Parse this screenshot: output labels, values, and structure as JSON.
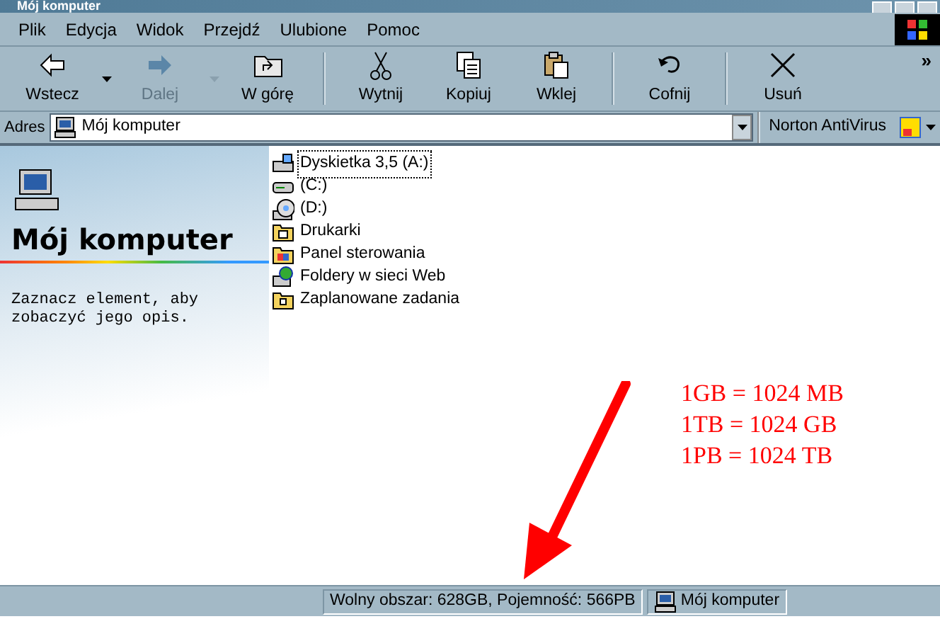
{
  "window": {
    "title": "Mój komputer"
  },
  "menu": [
    "Plik",
    "Edycja",
    "Widok",
    "Przejdź",
    "Ulubione",
    "Pomoc"
  ],
  "toolbar": [
    {
      "label": "Wstecz",
      "kind": "back",
      "disabled": false,
      "dropdown": true,
      "separator_after": false
    },
    {
      "label": "Dalej",
      "kind": "forward",
      "disabled": true,
      "dropdown": true,
      "separator_after": false
    },
    {
      "label": "W górę",
      "kind": "up",
      "disabled": false,
      "dropdown": false,
      "separator_after": true
    },
    {
      "label": "Wytnij",
      "kind": "cut",
      "disabled": false,
      "dropdown": false,
      "separator_after": false
    },
    {
      "label": "Kopiuj",
      "kind": "copy",
      "disabled": false,
      "dropdown": false,
      "separator_after": false
    },
    {
      "label": "Wklej",
      "kind": "paste",
      "disabled": false,
      "dropdown": false,
      "separator_after": true
    },
    {
      "label": "Cofnij",
      "kind": "undo",
      "disabled": false,
      "dropdown": false,
      "separator_after": true
    },
    {
      "label": "Usuń",
      "kind": "delete",
      "disabled": false,
      "dropdown": false,
      "separator_after": false
    }
  ],
  "toolbar_overflow": "»",
  "address": {
    "label": "Adres",
    "value": "Mój komputer"
  },
  "norton": {
    "label": "Norton AntiVirus"
  },
  "info_panel": {
    "title": "Mój komputer",
    "description": "Zaznacz element, aby zobaczyć jego opis."
  },
  "items": [
    {
      "label": "Dyskietka 3,5 (A:)",
      "kind": "floppy",
      "selected": true
    },
    {
      "label": "(C:)",
      "kind": "hdd",
      "selected": false
    },
    {
      "label": "(D:)",
      "kind": "cd",
      "selected": false
    },
    {
      "label": "Drukarki",
      "kind": "printers",
      "selected": false
    },
    {
      "label": "Panel sterowania",
      "kind": "control",
      "selected": false
    },
    {
      "label": "Foldery w sieci Web",
      "kind": "web",
      "selected": false
    },
    {
      "label": "Zaplanowane zadania",
      "kind": "tasks",
      "selected": false
    }
  ],
  "annotation": {
    "lines": [
      "1GB = 1024 MB",
      "1TB = 1024 GB",
      "1PB = 1024 TB"
    ]
  },
  "status_bar": {
    "text": "Wolny obszar: 628GB, Pojemność: 566PB",
    "location": "Mój komputer"
  }
}
